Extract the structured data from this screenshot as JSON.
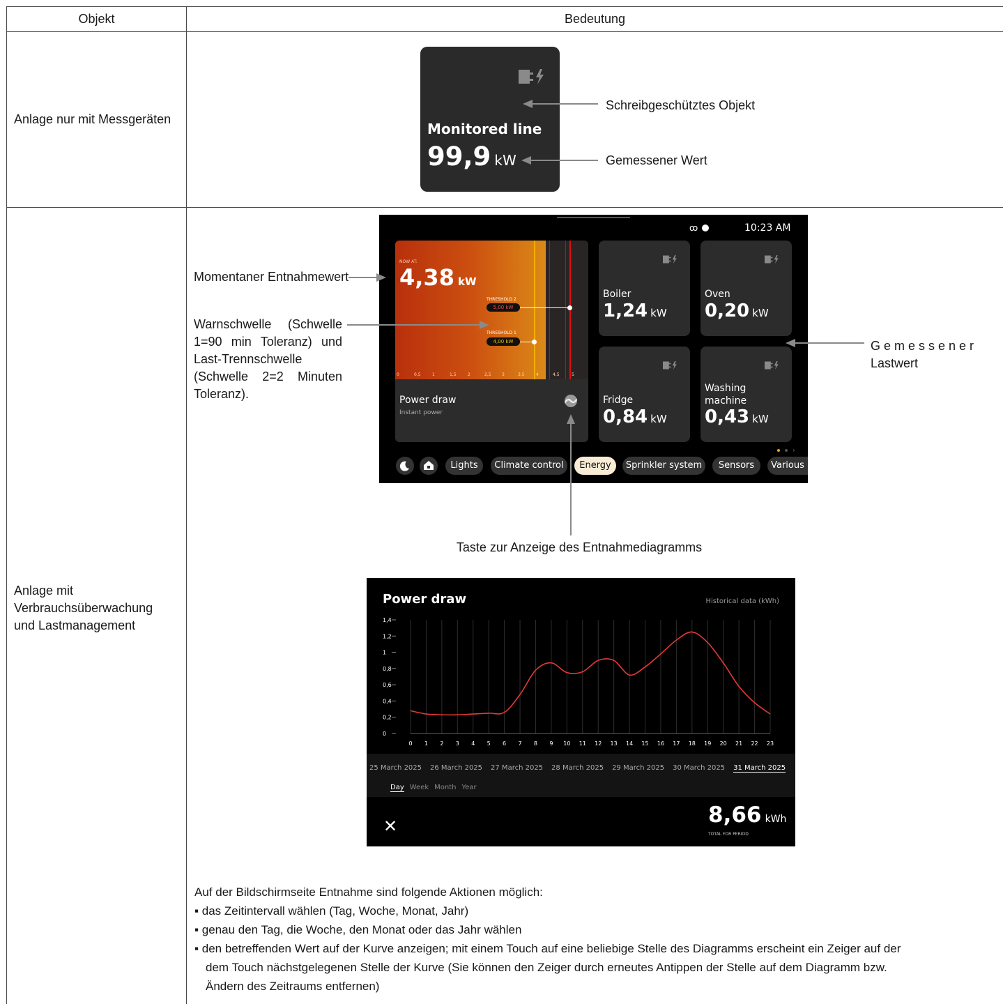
{
  "table": {
    "header_object": "Objekt",
    "header_meaning": "Bedeutung",
    "row1_label": "Anlage nur mit Messgeräten",
    "row2_label": "Anlage mit Verbrauchsüberwachung und Lastmanagement"
  },
  "tile1": {
    "title": "Monitored line",
    "value": "99,9",
    "unit": "kW",
    "label_readonly": "Schreibgeschütztes Objekt",
    "label_measured": "Gemessener Wert"
  },
  "annotations": {
    "current": "Momentaner Entnahmewert",
    "threshold_l1": "Warnschwelle (Schwelle",
    "threshold_l2": "1=90 min Toleranz) und",
    "threshold_l3": "Last-Trennschwelle",
    "threshold_l4": "(Schwelle 2=2 Minuten",
    "threshold_l5": "Toleranz).",
    "load_l1": "Gemessener",
    "load_l2": "Lastwert",
    "button": "Taste zur Anzeige des Entnahmediagramms"
  },
  "device": {
    "time": "10:23 AM",
    "now_at": "NOW AT:",
    "now_value": "4,38",
    "now_unit": "kW",
    "threshold2_label": "THRESHOLD 2",
    "threshold2_value": "5,00 kW",
    "threshold1_label": "THRESHOLD 1",
    "threshold1_value": "4,00 kW",
    "scale": [
      "0",
      "0,5",
      "1",
      "1,5",
      "2",
      "2,5",
      "3",
      "3,5",
      "4",
      "4,5",
      "5"
    ],
    "power_title": "Power draw",
    "power_sub": "Instant power",
    "loads": [
      {
        "name": "Boiler",
        "value": "1,24",
        "unit": "kW"
      },
      {
        "name": "Oven",
        "value": "0,20",
        "unit": "kW"
      },
      {
        "name": "Fridge",
        "value": "0,84",
        "unit": "kW"
      },
      {
        "name": "Washing machine",
        "value": "0,43",
        "unit": "kW"
      }
    ],
    "tabs": [
      "Lights",
      "Climate control",
      "Energy",
      "Sprinkler system",
      "Sensors",
      "Various"
    ],
    "active_tab": "Energy"
  },
  "history": {
    "title": "Power draw",
    "subtitle": "Historical data (kWh)",
    "dates": [
      "25 March 2025",
      "26 March 2025",
      "27 March 2025",
      "28 March 2025",
      "29 March 2025",
      "30 March 2025",
      "31 March 2025"
    ],
    "selected_date": "31 March 2025",
    "periods": [
      "Day",
      "Week",
      "Month",
      "Year"
    ],
    "selected_period": "Day",
    "total_value": "8,66",
    "total_unit": "kWh",
    "total_label": "TOTAL FOR PERIOD"
  },
  "chart_data": {
    "type": "line",
    "title": "Power draw",
    "subtitle": "Historical data (kWh)",
    "x": [
      0,
      1,
      2,
      3,
      4,
      5,
      6,
      7,
      8,
      9,
      10,
      11,
      12,
      13,
      14,
      15,
      16,
      17,
      18,
      19,
      20,
      21,
      22,
      23
    ],
    "xticks": [
      "0",
      "1",
      "2",
      "3",
      "4",
      "5",
      "6",
      "7",
      "8",
      "9",
      "10",
      "11",
      "12",
      "13",
      "14",
      "15",
      "16",
      "17",
      "18",
      "19",
      "20",
      "21",
      "22",
      "23"
    ],
    "yticks": [
      "0",
      "0,2",
      "0,4",
      "0,6",
      "0,8",
      "1",
      "1,2",
      "1,4"
    ],
    "ylim": [
      0,
      1.4
    ],
    "series": [
      {
        "values": [
          0.28,
          0.24,
          0.23,
          0.23,
          0.24,
          0.25,
          0.26,
          0.48,
          0.78,
          0.87,
          0.75,
          0.76,
          0.9,
          0.9,
          0.72,
          0.82,
          0.98,
          1.15,
          1.25,
          1.12,
          0.87,
          0.58,
          0.38,
          0.24
        ],
        "color": "#e53935"
      }
    ],
    "grid": true
  },
  "footer": {
    "intro": "Auf der Bildschirmseite Entnahme sind folgende Aktionen möglich:",
    "bullet1": "▪ das Zeitintervall wählen (Tag, Woche, Monat, Jahr)",
    "bullet2": "▪ genau den Tag, die Woche, den Monat oder das Jahr wählen",
    "bullet3_l1": "▪ den betreffenden Wert auf der Kurve anzeigen; mit einem Touch auf eine beliebige Stelle des Diagramms erscheint ein Zeiger auf der",
    "bullet3_l2": "dem Touch nächstgelegenen Stelle der Kurve (Sie können den Zeiger durch erneutes Antippen der Stelle auf dem Diagramm bzw.",
    "bullet3_l3": "Ändern des Zeitraums entfernen)"
  }
}
